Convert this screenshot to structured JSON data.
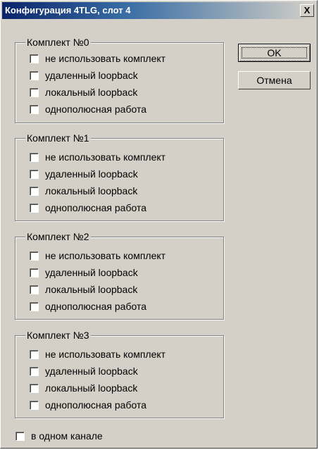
{
  "window": {
    "title": "Конфигурация 4TLG, слот 4",
    "close_label": "X"
  },
  "buttons": {
    "ok": "OK",
    "cancel": "Отмена"
  },
  "options": {
    "labels": [
      "не использовать комплект",
      "удаленный loopback",
      "локальный loopback",
      "однополюсная работа"
    ]
  },
  "groups": [
    {
      "title": "Комплект №0",
      "checked": [
        false,
        false,
        false,
        false
      ]
    },
    {
      "title": "Комплект №1",
      "checked": [
        false,
        false,
        false,
        false
      ]
    },
    {
      "title": "Комплект №2",
      "checked": [
        false,
        false,
        false,
        false
      ]
    },
    {
      "title": "Комплект №3",
      "checked": [
        false,
        false,
        false,
        false
      ]
    }
  ],
  "single_channel": {
    "label": "в одном канале",
    "checked": false
  }
}
